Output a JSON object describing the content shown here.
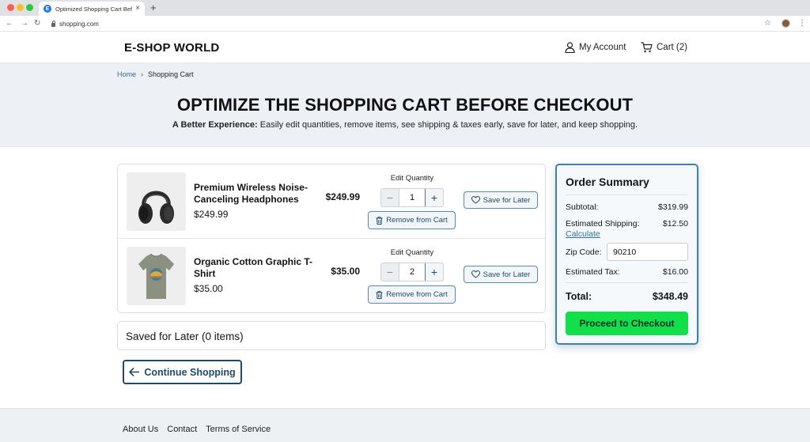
{
  "browser": {
    "tab_title": "Optimized Shopping Cart Before Checkout",
    "tab_favicon": "E",
    "url": "shopping.com"
  },
  "header": {
    "logo": "E-SHOP WORLD",
    "account_label": "My Account",
    "cart_label": "Cart (2)"
  },
  "breadcrumb": {
    "home": "Home",
    "separator": "›",
    "current": "Shopping Cart"
  },
  "hero": {
    "title": "OPTIMIZE THE SHOPPING CART BEFORE CHECKOUT",
    "subtitle_bold": "A Better Experience:",
    "subtitle_text": " Easily edit quantities, remove items, see shipping & taxes early, save for later, and keep shopping."
  },
  "cart": {
    "items": [
      {
        "name": "Premium Wireless Noise-Canceling Headphones",
        "sub_price": "$249.99",
        "price": "$249.99",
        "qty_label": "Edit Quantity",
        "quantity": "1",
        "remove_label": "Remove from Cart",
        "save_label": "Save for Later",
        "image_icon": "headphones-image"
      },
      {
        "name": "Organic Cotton Graphic T-Shirt",
        "sub_price": "$35.00",
        "price": "$35.00",
        "qty_label": "Edit Quantity",
        "quantity": "2",
        "remove_label": "Remove from Cart",
        "save_label": "Save for Later",
        "image_icon": "tshirt-image"
      }
    ]
  },
  "saved_for_later": {
    "title": "Saved for Later (0 items)"
  },
  "continue_label": "Continue Shopping",
  "summary": {
    "title": "Order Summary",
    "subtotal_label": "Subtotal:",
    "subtotal_value": "$319.99",
    "shipping_label": "Estimated Shipping:",
    "shipping_value": "$12.50",
    "calculate_label": "Calculate",
    "zip_label": "Zip Code:",
    "zip_value": "90210",
    "tax_label": "Estimated Tax:",
    "tax_value": "$16.00",
    "total_label": "Total:",
    "total_value": "$348.49",
    "checkout_label": "Proceed to Checkout"
  },
  "footer": {
    "links": [
      "About Us",
      "Contact",
      "Terms of Service"
    ]
  },
  "colors": {
    "accent": "#1e4a68",
    "summary_border": "#3c80b0",
    "checkout_green": "#12e04a",
    "hero_bg": "#edf1f5",
    "link": "#2f6f95"
  }
}
